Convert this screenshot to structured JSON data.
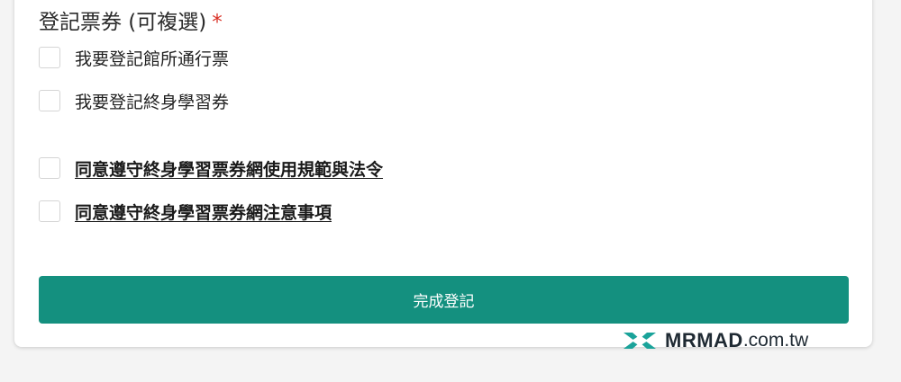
{
  "section": {
    "title": "登記票券 (可複選)",
    "required_mark": "*"
  },
  "options": [
    {
      "label": "我要登記館所通行票",
      "checked": false
    },
    {
      "label": "我要登記終身學習券",
      "checked": false
    }
  ],
  "agreements": [
    {
      "label": "同意遵守終身學習票券網使用規範與法令",
      "checked": false
    },
    {
      "label": "同意遵守終身學習票券網注意事項",
      "checked": false
    }
  ],
  "submit": {
    "label": "完成登記"
  },
  "watermark": {
    "brand": "MRMAD",
    "domain": ".com.tw"
  },
  "colors": {
    "accent": "#14907f",
    "required": "#d93025",
    "logo": "#1aa39a"
  }
}
